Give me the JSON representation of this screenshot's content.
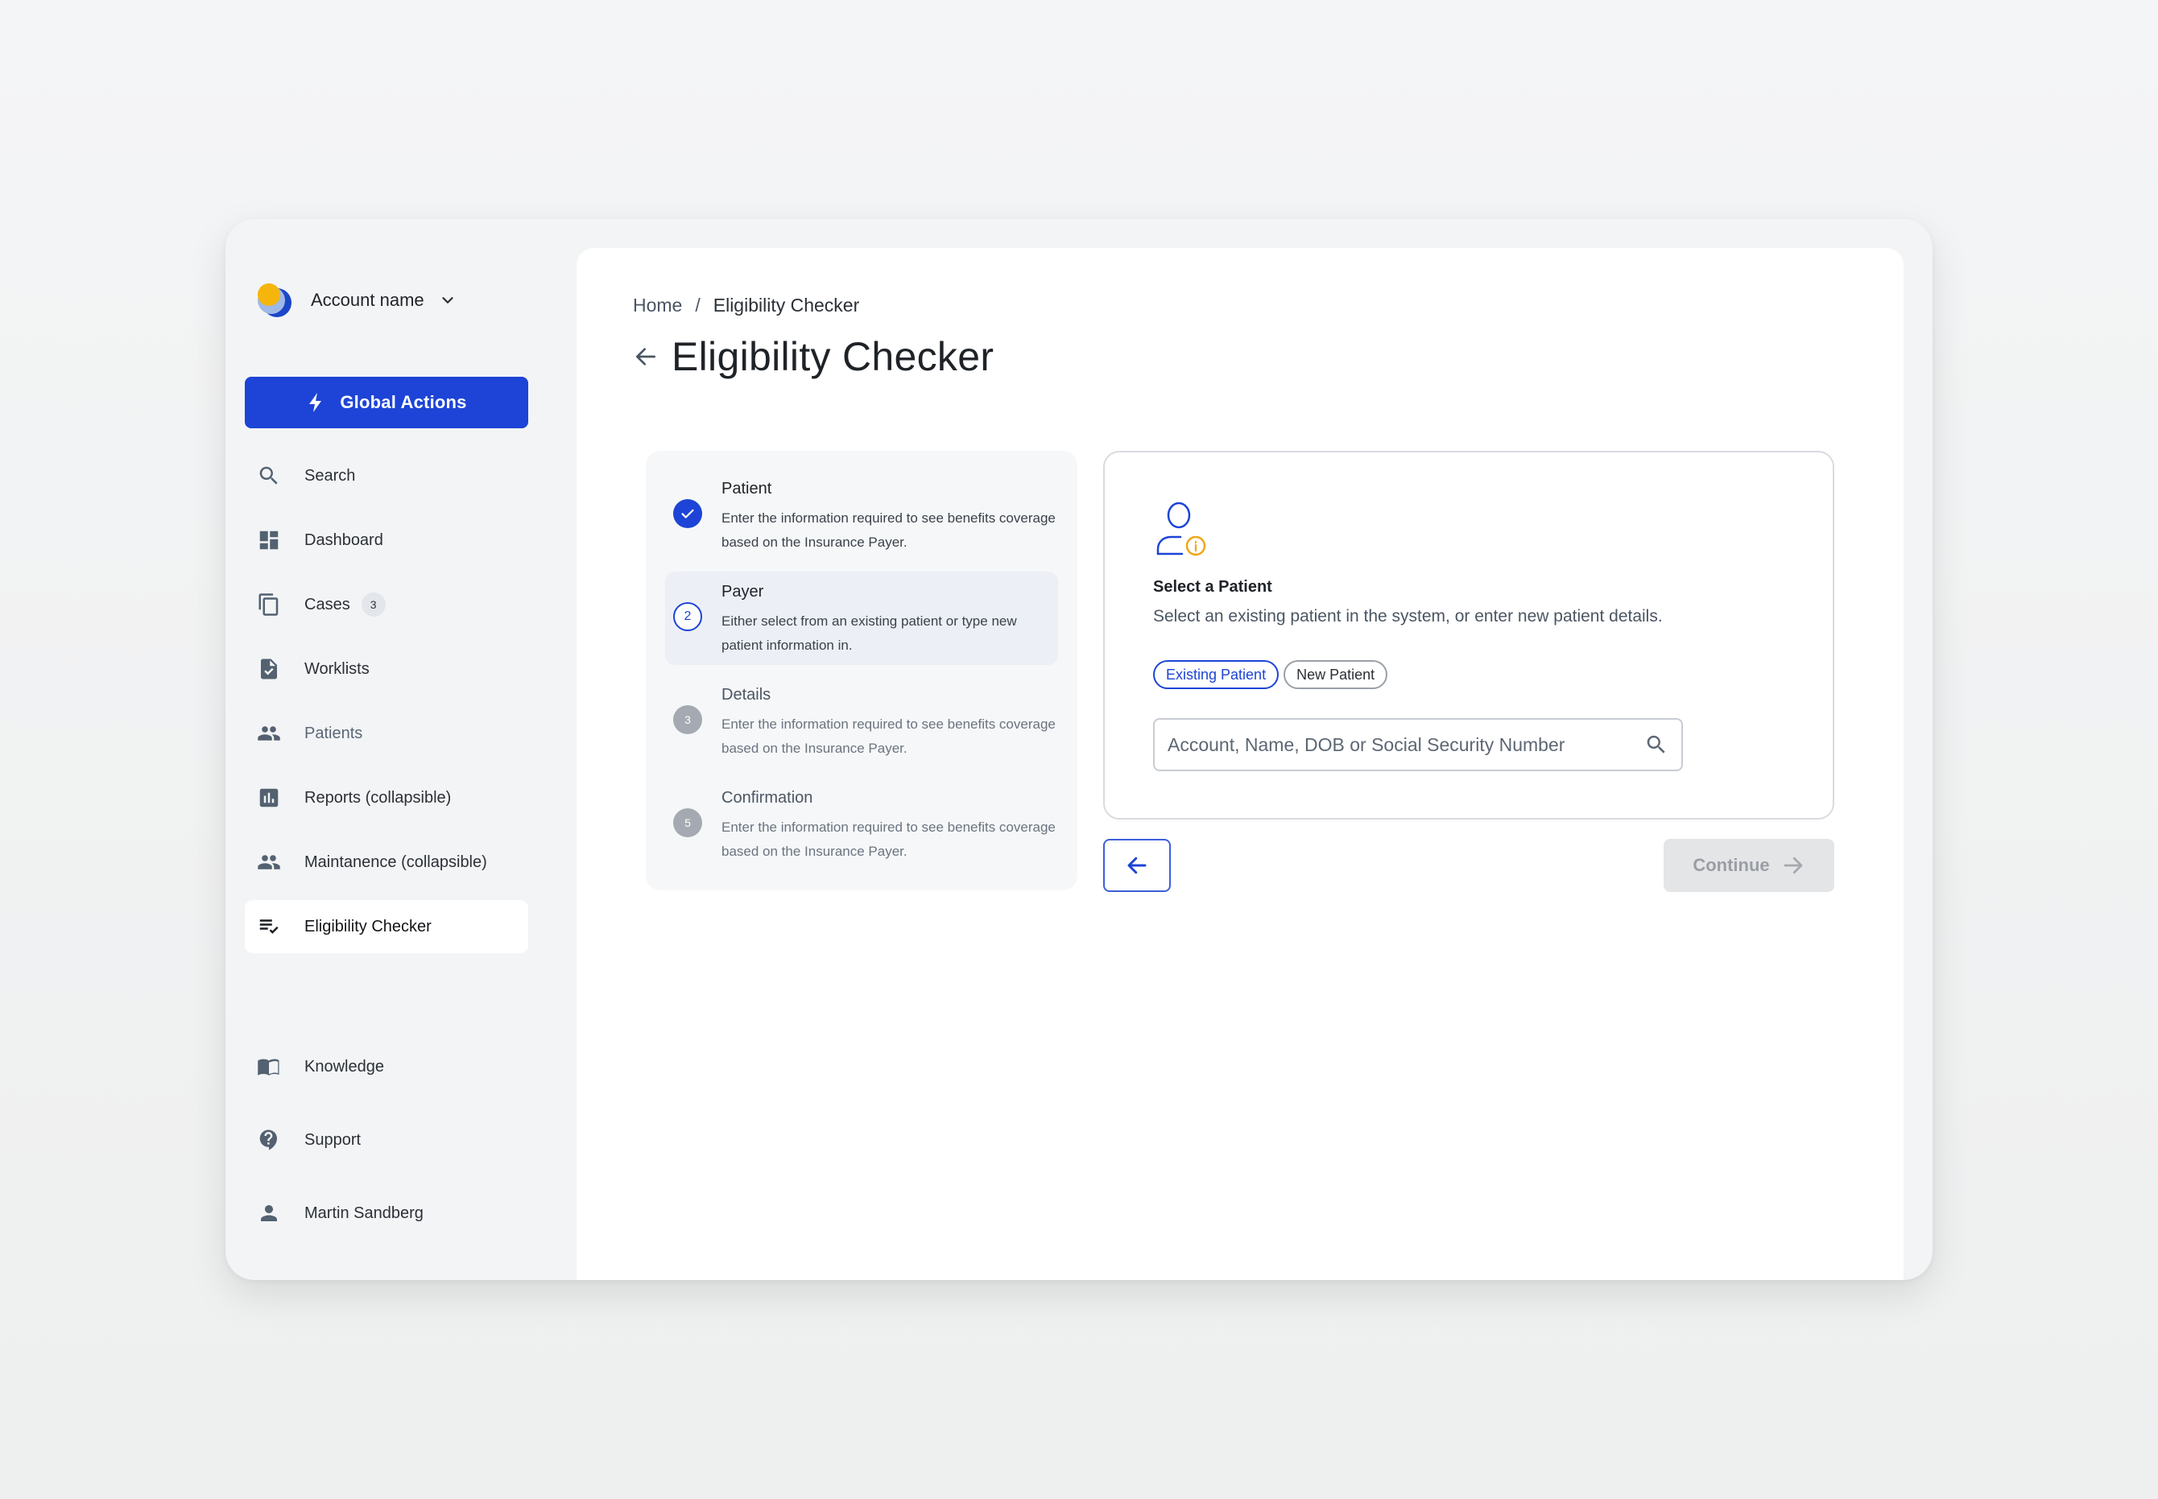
{
  "account": {
    "name": "Account name",
    "logo_icon": "account-logo",
    "dropdown_icon": "chevron-down-icon"
  },
  "global_actions": {
    "label": "Global Actions",
    "icon": "bolt-icon",
    "color": "#1d44d6"
  },
  "nav": {
    "items": [
      {
        "label": "Search",
        "icon": "search-icon"
      },
      {
        "label": "Dashboard",
        "icon": "dashboard-icon"
      },
      {
        "label": "Cases",
        "icon": "files-icon",
        "badge": "3"
      },
      {
        "label": "Worklists",
        "icon": "document-check-icon"
      },
      {
        "label": "Patients",
        "icon": "people-icon"
      },
      {
        "label": "Reports (collapsible)",
        "icon": "bar-chart-icon"
      },
      {
        "label": "Maintanence (collapsible)",
        "icon": "people-icon"
      },
      {
        "label": "Eligibility Checker",
        "icon": "list-check-icon",
        "active": true
      }
    ],
    "bottom": [
      {
        "label": "Knowledge",
        "icon": "book-icon"
      },
      {
        "label": "Support",
        "icon": "help-icon"
      },
      {
        "label": "Martin Sandberg",
        "icon": "user-icon"
      }
    ]
  },
  "breadcrumb": {
    "home": "Home",
    "separator": "/",
    "current": "Eligibility Checker"
  },
  "page": {
    "title": "Eligibility Checker"
  },
  "steps": [
    {
      "title": "Patient",
      "desc": "Enter the information required to see benefits coverage based on the Insurance Payer.",
      "state": "done"
    },
    {
      "title": "Payer",
      "number": "2",
      "desc": "Either select from an existing patient or type new patient information in.",
      "state": "current"
    },
    {
      "title": "Details",
      "number": "3",
      "desc": "Enter the information required to see benefits coverage based on the Insurance Payer.",
      "state": "todo"
    },
    {
      "title": "Confirmation",
      "number": "5",
      "desc": "Enter the information required to see benefits coverage based on the Insurance Payer.",
      "state": "todo"
    }
  ],
  "card": {
    "icon": "patient-info-icon",
    "title": "Select a Patient",
    "subtitle": "Select an existing patient in the system, or enter new patient details.",
    "toggle": {
      "existing": "Existing Patient",
      "new": "New Patient",
      "selected": "Existing Patient"
    },
    "search": {
      "placeholder": "Account, Name, DOB or Social Security Number",
      "value": ""
    }
  },
  "footer": {
    "back_icon": "arrow-left-icon",
    "continue_label": "Continue",
    "continue_icon": "arrow-right-icon"
  }
}
